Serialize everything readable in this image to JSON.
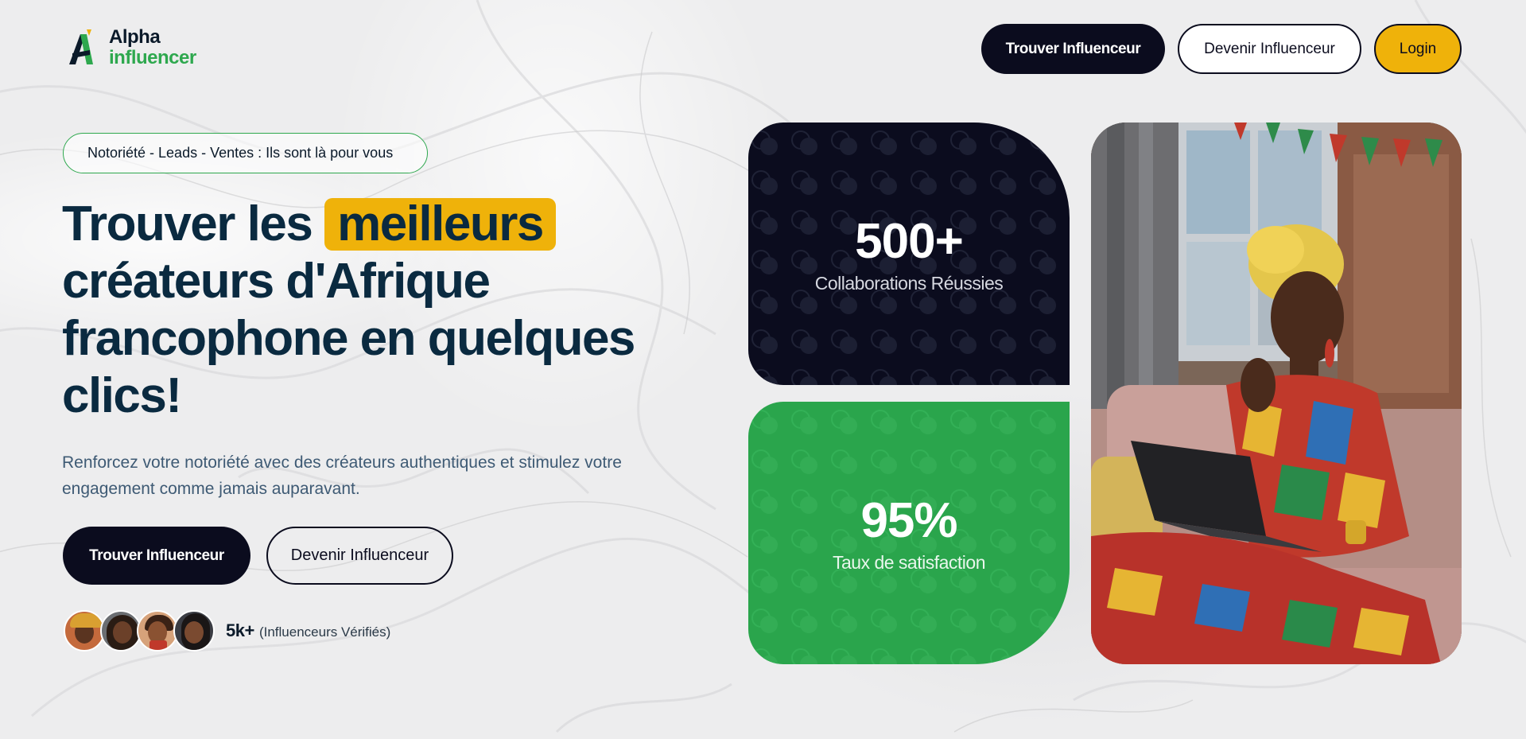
{
  "brand": {
    "line1": "Alpha",
    "line2": "influencer",
    "colors": {
      "dark": "#0b0c1e",
      "green": "#2ea84e",
      "yellow": "#efb20a",
      "navy": "#0a2a40"
    }
  },
  "nav": {
    "find_label": "Trouver Influenceur",
    "become_label": "Devenir Influenceur",
    "login_label": "Login"
  },
  "hero": {
    "tagline": "Notoriété - Leads - Ventes : Ils sont là pour vous",
    "headline_before": "Trouver les",
    "headline_highlight": "meilleurs",
    "headline_after": "créateurs d'Afrique francophone en quelques clics!",
    "subtitle": "Renforcez votre notoriété avec des créateurs authentiques et stimulez votre engagement comme jamais auparavant.",
    "cta_find_label": "Trouver Influenceur",
    "cta_become_label": "Devenir Influenceur",
    "social_count": "5k+",
    "social_label": "(Influenceurs Vérifiés)"
  },
  "stats": {
    "collab_value": "500+",
    "collab_label": "Collaborations Réussies",
    "satisfaction_value": "95%",
    "satisfaction_label": "Taux de satisfaction"
  },
  "icons": [
    "logo-icon",
    "avatar-1",
    "avatar-2",
    "avatar-3",
    "avatar-4",
    "hero-photo"
  ]
}
